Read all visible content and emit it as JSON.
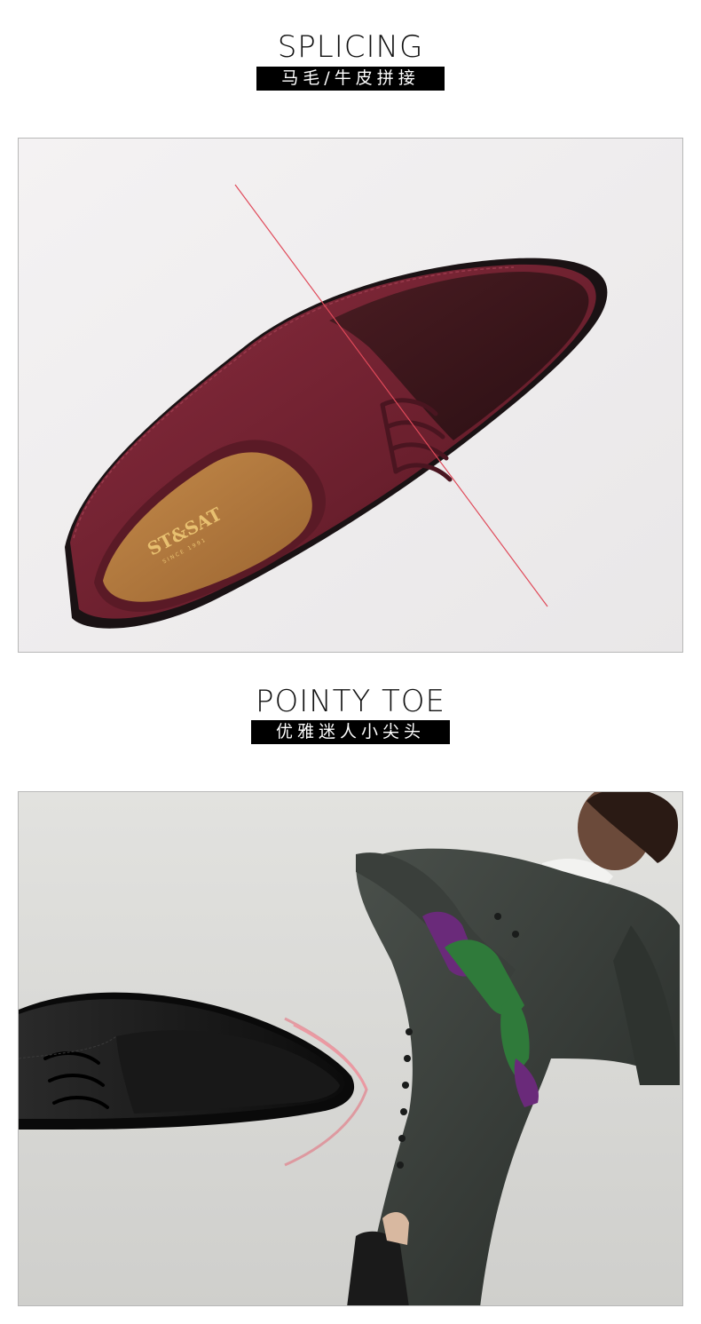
{
  "section1": {
    "title": "SPLICING",
    "subtitle": "马毛/牛皮拼接",
    "photo": {
      "subject": "burgundy-lace-up-shoe-pony-hair-leather-splicing",
      "insole_logo": "ST&SAT",
      "insole_logo_sub": "SINCE 1991"
    }
  },
  "section2": {
    "title": "POINTY TOE",
    "subtitle": "优雅迷人小尖头",
    "photo": {
      "subject": "black-pointy-toe-shoe-with-model-in-dark-coat"
    }
  },
  "colors": {
    "burgundy": "#6e2030",
    "ponyhair": "#3a1418",
    "black_shoe": "#141414",
    "coat": "#3b403c",
    "glove_green": "#2f7a3a",
    "glove_purple": "#6a2a7a",
    "guide_line": "#e04a5a"
  }
}
